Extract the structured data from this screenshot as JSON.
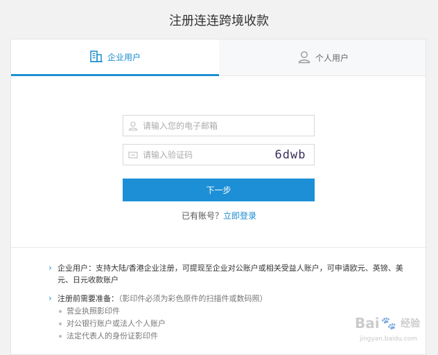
{
  "page": {
    "title": "注册连连跨境收款"
  },
  "tabs": [
    {
      "label": "企业用户",
      "icon": "building-icon",
      "active": true
    },
    {
      "label": "个人用户",
      "icon": "person-icon",
      "active": false
    }
  ],
  "form": {
    "email_placeholder": "请输入您的电子邮箱",
    "code_placeholder": "请输入验证码",
    "captcha_text": "6dwb",
    "next_label": "下一步",
    "has_account": "已有账号？",
    "login_link": "立即登录"
  },
  "info": {
    "enterprise_label": "企业用户：",
    "enterprise_text": "支持大陆/香港企业注册，可提现至企业对公账户或相关受益人账户，可申请欧元、英镑、美元、日元收款账户",
    "prep_label": "注册前需要准备：",
    "prep_note": "（影印件必须为彩色原件的扫描件或数码照）",
    "prep_items": [
      "营业执照影印件",
      "对公银行账户或法人个人账户",
      "法定代表人的身份证影印件"
    ]
  },
  "watermark": {
    "text": "Bai 经验",
    "url": "jingyan.baidu.com"
  },
  "colors": {
    "accent": "#1d8fd6",
    "background": "#f2f2f2"
  }
}
